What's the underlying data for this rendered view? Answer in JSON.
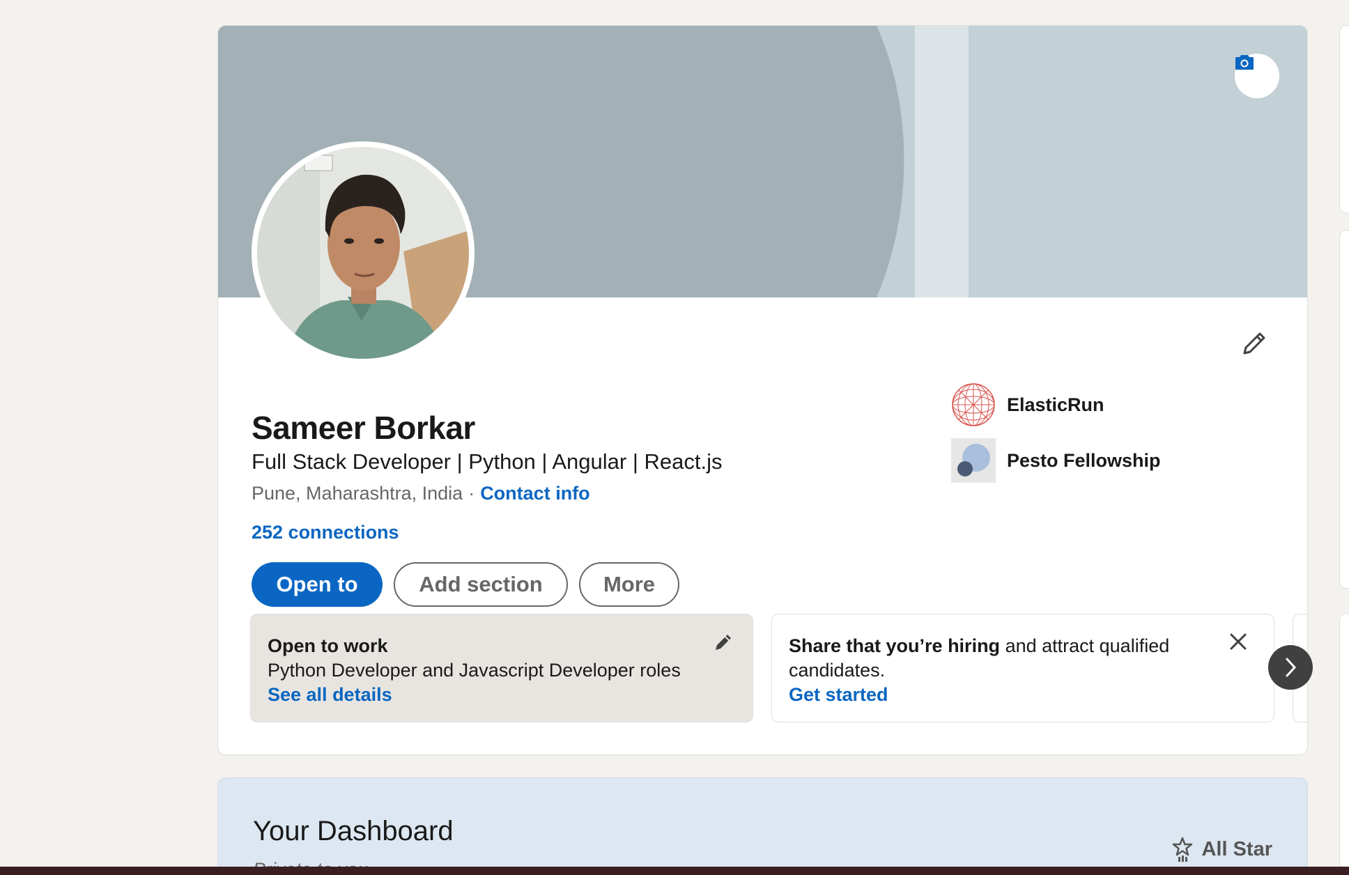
{
  "profile": {
    "name": "Sameer Borkar",
    "headline": "Full Stack Developer | Python | Angular | React.js",
    "location": "Pune, Maharashtra, India",
    "contact_info_label": "Contact info",
    "connections_label": "252 connections"
  },
  "actions": {
    "open_to": "Open to",
    "add_section": "Add section",
    "more": "More"
  },
  "companies": [
    {
      "name": "ElasticRun",
      "icon": "elasticrun-logo"
    },
    {
      "name": "Pesto Fellowship",
      "icon": "pesto-logo"
    }
  ],
  "open_to_work_card": {
    "title": "Open to work",
    "description": "Python Developer and Javascript Developer roles",
    "link": "See all details"
  },
  "hiring_card": {
    "title_bold": "Share that you’re hiring",
    "title_rest": " and attract qualified candidates.",
    "link": "Get started"
  },
  "dashboard": {
    "title": "Your Dashboard",
    "subtitle": "Private to you",
    "all_star_label": "All Star"
  },
  "colors": {
    "accent": "#0a66c2",
    "banner_left": "#a3b1b6",
    "banner_right": "#c3d1d6",
    "open_card_bg": "#e8e5e1"
  }
}
